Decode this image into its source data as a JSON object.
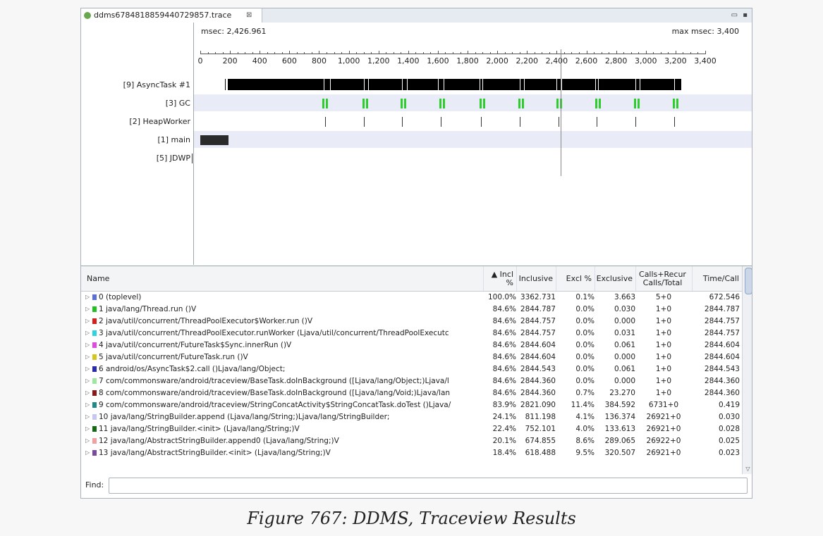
{
  "tab": {
    "title": "ddms6784818859440729857.trace",
    "close_glyph": "⊠"
  },
  "window_controls": {
    "minimize": "▭",
    "maximize": "▪"
  },
  "timeline": {
    "current_label": "msec: 2,426.961",
    "max_label": "max msec: 3,400",
    "axis_max": 3400,
    "cursor_msec": 2426.961,
    "ticks": [
      "0",
      "200",
      "400",
      "600",
      "800",
      "1,000",
      "1,200",
      "1,400",
      "1,600",
      "1,800",
      "2,000",
      "2,200",
      "2,400",
      "2,600",
      "2,800",
      "3,000",
      "3,200",
      "3,400"
    ],
    "threads": [
      {
        "label": "[9] AsyncTask #1"
      },
      {
        "label": "[3] GC"
      },
      {
        "label": "[2] HeapWorker"
      },
      {
        "label": "[1] main"
      },
      {
        "label": "[5] JDWP"
      }
    ],
    "async_segments": [
      [
        185,
        830
      ],
      [
        835,
        875
      ],
      [
        880,
        1100
      ],
      [
        1105,
        1130
      ],
      [
        1135,
        1360
      ],
      [
        1365,
        1390
      ],
      [
        1395,
        1600
      ],
      [
        1605,
        1640
      ],
      [
        1645,
        1880
      ],
      [
        1885,
        1900
      ],
      [
        1905,
        2150
      ],
      [
        2155,
        2180
      ],
      [
        2185,
        2400
      ],
      [
        2405,
        2430
      ],
      [
        2435,
        2660
      ],
      [
        2665,
        2680
      ],
      [
        2685,
        2930
      ],
      [
        2935,
        2960
      ],
      [
        2965,
        3190
      ],
      [
        3195,
        3240
      ]
    ],
    "gc_marks": [
      820,
      1090,
      1350,
      1610,
      1880,
      2140,
      2400,
      2660,
      2920,
      3180
    ],
    "heap_marks": [
      840,
      1100,
      1360,
      1620,
      1890,
      2150,
      2410,
      2670,
      2930,
      3190
    ],
    "main_block": [
      0,
      190
    ],
    "jdwp_mark": 0,
    "colors": {
      "async": "#000000",
      "gc": "#2ecc2e",
      "heap": "#333333",
      "main": "#2b2b2b",
      "band": "#e9ecf7"
    }
  },
  "profile": {
    "headers": {
      "name": "Name",
      "incl_pct": "▲ Incl %",
      "inclusive": "Inclusive",
      "excl_pct": "Excl %",
      "exclusive": "Exclusive",
      "calls": "Calls+Recur\nCalls/Total",
      "time_call": "Time/Call"
    },
    "rows": [
      {
        "color": "#5b6fd6",
        "name": "0 (toplevel)",
        "incl_pct": "100.0%",
        "inclusive": "3362.731",
        "excl_pct": "0.1%",
        "exclusive": "3.663",
        "calls": "5+0",
        "time_call": "672.546"
      },
      {
        "color": "#22c022",
        "name": "1 java/lang/Thread.run ()V",
        "incl_pct": "84.6%",
        "inclusive": "2844.787",
        "excl_pct": "0.0%",
        "exclusive": "0.030",
        "calls": "1+0",
        "time_call": "2844.787"
      },
      {
        "color": "#d62020",
        "name": "2 java/util/concurrent/ThreadPoolExecutor$Worker.run ()V",
        "incl_pct": "84.6%",
        "inclusive": "2844.757",
        "excl_pct": "0.0%",
        "exclusive": "0.000",
        "calls": "1+0",
        "time_call": "2844.757"
      },
      {
        "color": "#2ad4e0",
        "name": "3 java/util/concurrent/ThreadPoolExecutor.runWorker (Ljava/util/concurrent/ThreadPoolExecutc",
        "incl_pct": "84.6%",
        "inclusive": "2844.757",
        "excl_pct": "0.0%",
        "exclusive": "0.031",
        "calls": "1+0",
        "time_call": "2844.757"
      },
      {
        "color": "#e04ae0",
        "name": "4 java/util/concurrent/FutureTask$Sync.innerRun ()V",
        "incl_pct": "84.6%",
        "inclusive": "2844.604",
        "excl_pct": "0.0%",
        "exclusive": "0.061",
        "calls": "1+0",
        "time_call": "2844.604"
      },
      {
        "color": "#d6c61c",
        "name": "5 java/util/concurrent/FutureTask.run ()V",
        "incl_pct": "84.6%",
        "inclusive": "2844.604",
        "excl_pct": "0.0%",
        "exclusive": "0.000",
        "calls": "1+0",
        "time_call": "2844.604"
      },
      {
        "color": "#2a2ab0",
        "name": "6 android/os/AsyncTask$2.call ()Ljava/lang/Object;",
        "incl_pct": "84.6%",
        "inclusive": "2844.543",
        "excl_pct": "0.0%",
        "exclusive": "0.061",
        "calls": "1+0",
        "time_call": "2844.543"
      },
      {
        "color": "#9ee89e",
        "name": "7 com/commonsware/android/traceview/BaseTask.doInBackground ([Ljava/lang/Object;)Ljava/l",
        "incl_pct": "84.6%",
        "inclusive": "2844.360",
        "excl_pct": "0.0%",
        "exclusive": "0.000",
        "calls": "1+0",
        "time_call": "2844.360"
      },
      {
        "color": "#8a1a1a",
        "name": "8 com/commonsware/android/traceview/BaseTask.doInBackground ([Ljava/lang/Void;)Ljava/lan",
        "incl_pct": "84.6%",
        "inclusive": "2844.360",
        "excl_pct": "0.7%",
        "exclusive": "23.270",
        "calls": "1+0",
        "time_call": "2844.360"
      },
      {
        "color": "#1f8a8a",
        "name": "9 com/commonsware/android/traceview/StringConcatActivity$StringConcatTask.doTest ()Ljava/",
        "incl_pct": "83.9%",
        "inclusive": "2821.090",
        "excl_pct": "11.4%",
        "exclusive": "384.592",
        "calls": "6731+0",
        "time_call": "0.419"
      },
      {
        "color": "#c8c8ec",
        "name": "10 java/lang/StringBuilder.append (Ljava/lang/String;)Ljava/lang/StringBuilder;",
        "incl_pct": "24.1%",
        "inclusive": "811.198",
        "excl_pct": "4.1%",
        "exclusive": "136.374",
        "calls": "26921+0",
        "time_call": "0.030"
      },
      {
        "color": "#126a12",
        "name": "11 java/lang/StringBuilder.<init> (Ljava/lang/String;)V",
        "incl_pct": "22.4%",
        "inclusive": "752.101",
        "excl_pct": "4.0%",
        "exclusive": "133.613",
        "calls": "26921+0",
        "time_call": "0.028"
      },
      {
        "color": "#f0a0a0",
        "name": "12 java/lang/AbstractStringBuilder.append0 (Ljava/lang/String;)V",
        "incl_pct": "20.1%",
        "inclusive": "674.855",
        "excl_pct": "8.6%",
        "exclusive": "289.065",
        "calls": "26922+0",
        "time_call": "0.025"
      },
      {
        "color": "#7a4aa0",
        "name": "13 java/lang/AbstractStringBuilder.<init> (Ljava/lang/String;)V",
        "incl_pct": "18.4%",
        "inclusive": "618.488",
        "excl_pct": "9.5%",
        "exclusive": "320.507",
        "calls": "26921+0",
        "time_call": "0.023"
      }
    ]
  },
  "find": {
    "label": "Find:",
    "value": ""
  },
  "caption": "Figure 767: DDMS, Traceview Results"
}
